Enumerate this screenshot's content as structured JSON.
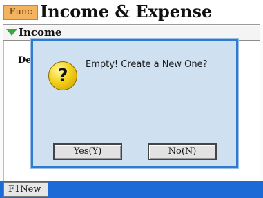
{
  "header": {
    "func_label": "Func",
    "title": "Income & Expense"
  },
  "section": {
    "label": "Income",
    "icon": "triangle-down-icon",
    "icon_color": "#3aa83a"
  },
  "content": {
    "column_header_partial": "De"
  },
  "dialog": {
    "icon": "question-icon",
    "message": "Empty! Create a New One?",
    "yes_label": "Yes(Y)",
    "no_label": "No(N)",
    "border_color": "#2f7ccf",
    "background_color": "#cfe0f1"
  },
  "footer": {
    "new_label": "F1New",
    "bar_color": "#1b6ad6"
  }
}
